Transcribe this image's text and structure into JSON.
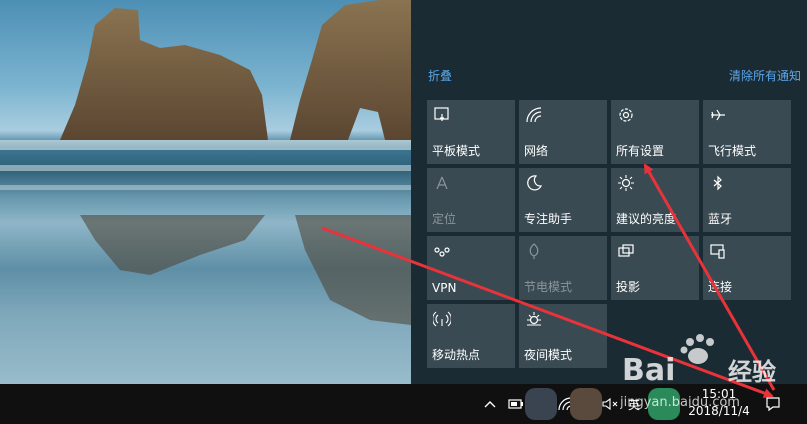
{
  "action_center": {
    "collapse_label": "折叠",
    "clear_all_label": "清除所有通知",
    "tiles": [
      {
        "label": "平板模式",
        "icon": "tablet-mode-icon",
        "enabled": true
      },
      {
        "label": "网络",
        "icon": "network-icon",
        "enabled": true
      },
      {
        "label": "所有设置",
        "icon": "settings-gear-icon",
        "enabled": true
      },
      {
        "label": "飞行模式",
        "icon": "airplane-icon",
        "enabled": true
      },
      {
        "label": "定位",
        "icon": "location-icon",
        "enabled": false
      },
      {
        "label": "专注助手",
        "icon": "moon-icon",
        "enabled": true
      },
      {
        "label": "建议的亮度",
        "icon": "brightness-icon",
        "enabled": true
      },
      {
        "label": "蓝牙",
        "icon": "bluetooth-icon",
        "enabled": true
      },
      {
        "label": "VPN",
        "icon": "vpn-icon",
        "enabled": true
      },
      {
        "label": "节电模式",
        "icon": "battery-saver-icon",
        "enabled": false
      },
      {
        "label": "投影",
        "icon": "project-icon",
        "enabled": true
      },
      {
        "label": "连接",
        "icon": "connect-icon",
        "enabled": true
      },
      {
        "label": "移动热点",
        "icon": "mobile-hotspot-icon",
        "enabled": true
      },
      {
        "label": "夜间模式",
        "icon": "night-light-icon",
        "enabled": true
      }
    ]
  },
  "taskbar": {
    "ime_label": "英",
    "clock_time": "15:01",
    "clock_date": "2018/11/4"
  },
  "watermark": {
    "brand": "Bai",
    "brand_suffix": "经验",
    "url": "jingyan.baidu.com"
  },
  "colors": {
    "accent": "#5aa6ea",
    "tile": "#3a4a52",
    "panel": "#1b2b33",
    "arrow": "#e8333a"
  }
}
